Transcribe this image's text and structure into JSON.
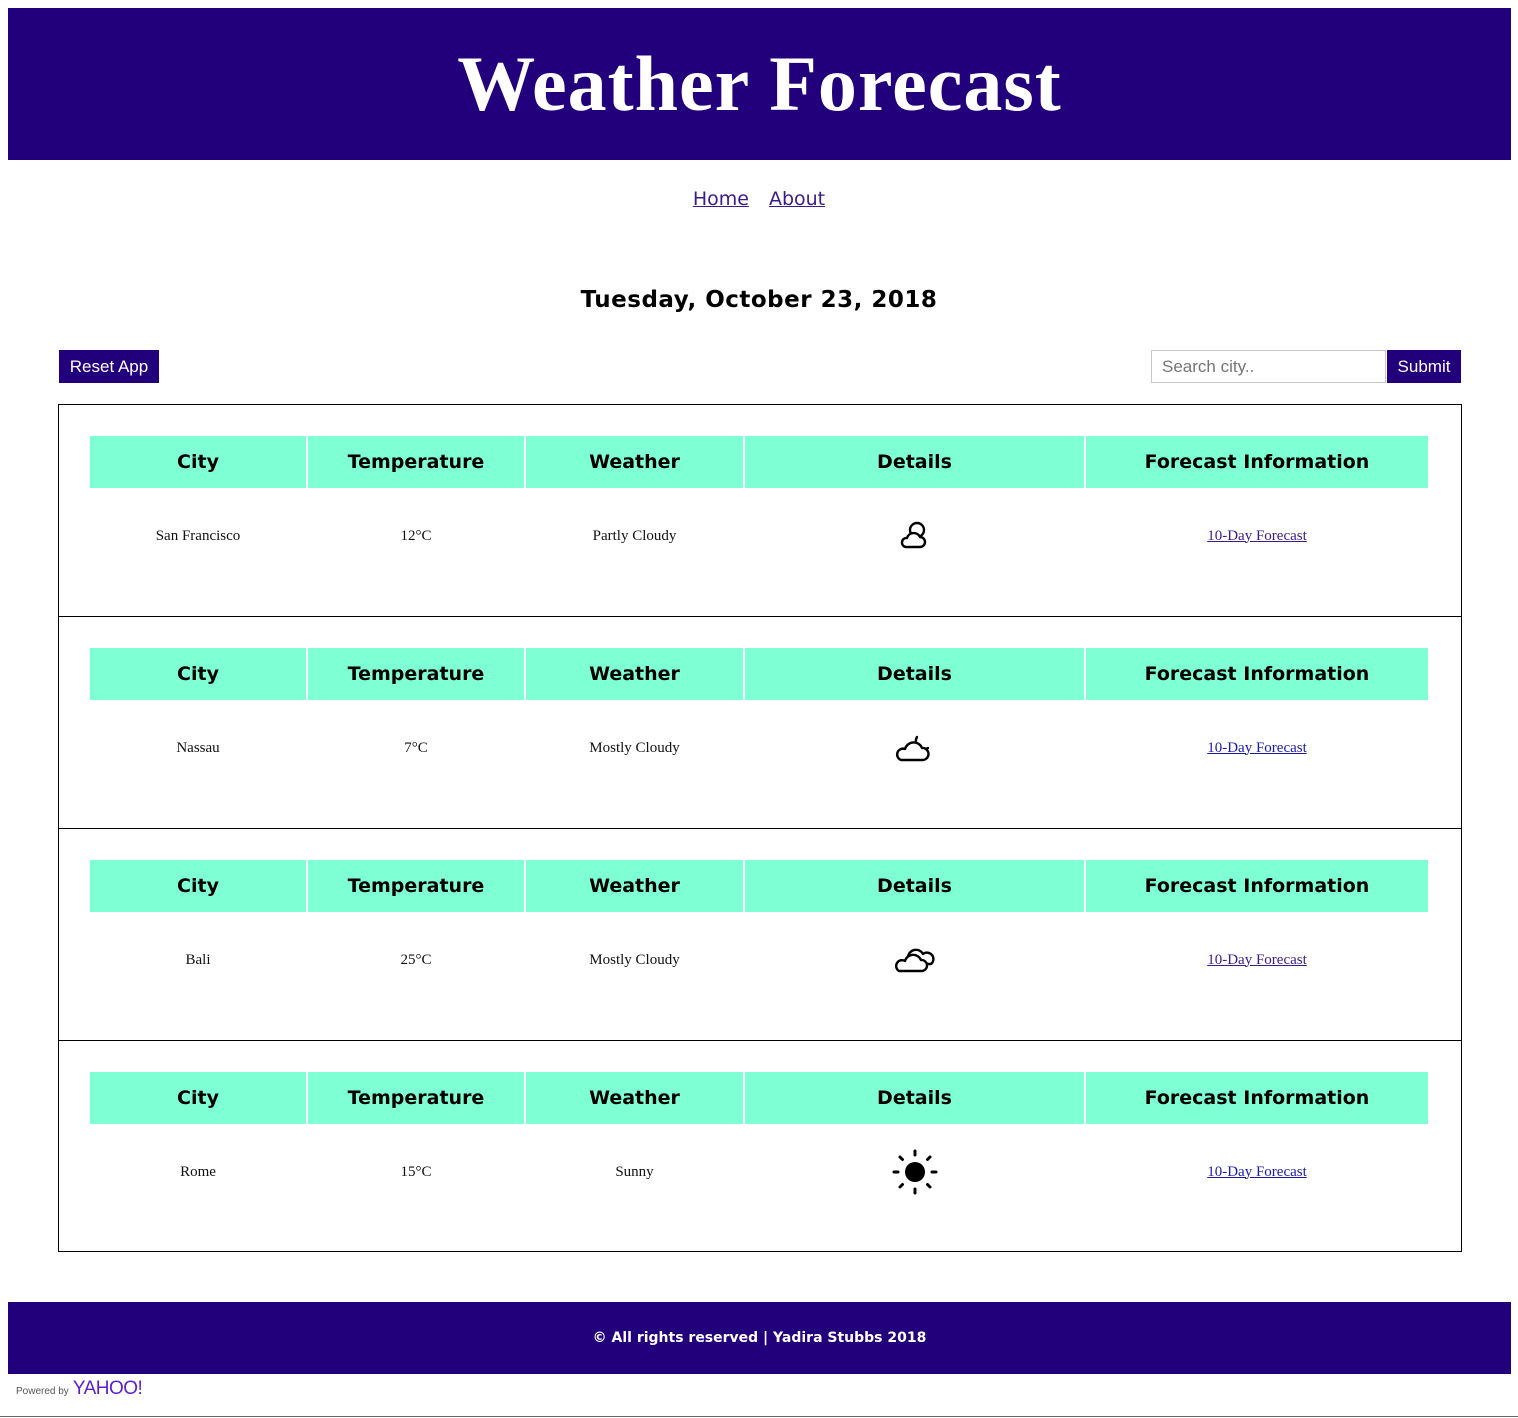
{
  "header": {
    "title": "Weather Forecast"
  },
  "nav": {
    "home": "Home",
    "about": "About"
  },
  "date": "Tuesday, October 23, 2018",
  "controls": {
    "reset_label": "Reset App",
    "search_placeholder": "Search city..",
    "submit_label": "Submit"
  },
  "table_headers": [
    "City",
    "Temperature",
    "Weather",
    "Details",
    "Forecast Information"
  ],
  "rows": [
    {
      "city": "San Francisco",
      "temperature": "12°C",
      "weather": "Partly Cloudy",
      "icon": "partly-cloudy-icon",
      "link": "10-Day Forecast"
    },
    {
      "city": "Nassau",
      "temperature": "7°C",
      "weather": "Mostly Cloudy",
      "icon": "cloud-moon-icon",
      "link": "10-Day Forecast"
    },
    {
      "city": "Bali",
      "temperature": "25°C",
      "weather": "Mostly Cloudy",
      "icon": "clouds-icon",
      "link": "10-Day Forecast"
    },
    {
      "city": "Rome",
      "temperature": "15°C",
      "weather": "Sunny",
      "icon": "sun-icon",
      "link": "10-Day Forecast"
    }
  ],
  "footer": {
    "text": "© All rights reserved | Yadira Stubbs 2018"
  },
  "powered": {
    "prefix": "Powered by",
    "brand": "YAHOO!"
  },
  "colors": {
    "primary": "#22007c",
    "header_cell": "#7fffd4",
    "link": "#3b1a8a"
  }
}
